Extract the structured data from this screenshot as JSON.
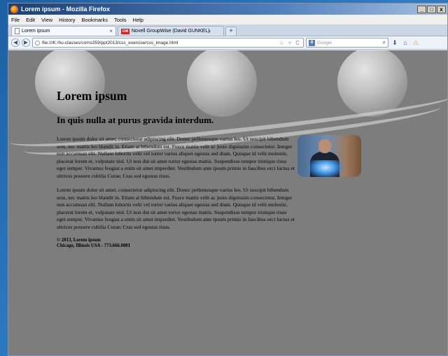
{
  "window": {
    "title": "Lorem ipsum - Mozilla Firefox",
    "controls": {
      "minimize": "_",
      "maximize": "□",
      "close": "x"
    }
  },
  "menu": [
    "File",
    "Edit",
    "View",
    "History",
    "Bookmarks",
    "Tools",
    "Help"
  ],
  "tabs": [
    {
      "label": "Lorem ipsum",
      "close": "×"
    },
    {
      "label": "Novell GroupWise (David GUNKEL)",
      "icon_text": "GW",
      "close": "×"
    }
  ],
  "newtab": "+",
  "nav": {
    "url": "file:///K:/hu-classes/coms359/ppt2013/css_exercise/css_image.html",
    "url_icons": "☆ ▿ C",
    "search_engine_icon": "8",
    "search_placeholder": "Google",
    "back": "◀",
    "forward": "▶",
    "magnifier": "⌕",
    "download": "⬇",
    "home": "⌂",
    "warning": "⚠"
  },
  "page": {
    "heading": "Lorem ipsum",
    "subheading": "In quis nulla at purus gravida interdum.",
    "paragraphs": [
      "Lorem ipsum dolor sit amet, consectetur adipiscing elit. Donec pellentesque varius leo. Ut suscipit bibendum sem, nec mattis leo blandit in. Etiam at bibendum est. Fusce mattis velit ac justo dignissim consectetur. Integer non accumsan elit. Nullam lobortis velit vel tortor varius aliquet egestas sed diam. Quisque id velit molestie, placerat lorem et, vulputate nisl. Ut non dui sit amet tortor egestas mattis. Suspendisse tempor tristique risus eget semper. Vivamus feugiat a enim sit amet imperdiet. Vestibulum ante ipsum primis in faucibus orci luctus et ultrices posuere cubilia Curae; Cras sed egestas risus.",
      "Lorem ipsum dolor sit amet, consectetur adipiscing elit. Donec pellentesque varius leo. Ut suscipit bibendum sem, nec mattis leo blandit in. Etiam at bibendum est. Fusce mattis velit ac justo dignissim consectetur. Integer non accumsan elit. Nullam lobortis velit vel tortor varius aliquet egestas sed diam. Quisque id velit molestie, placerat lorem et, vulputate nisl. Ut non dui sit amet tortor egestas mattis. Suspendisse tempor tristique risus eget semper. Vivamus feugiat a enim sit amet imperdiet. Vestibulum ante ipsum primis in faucibus orci luctus et ultrices posuere cubilia Curae; Cras sed egestas risus."
    ],
    "footer_line1": "© 2013, Lorem ipsum",
    "footer_line2": "Chicago, Illinois USA - 773.666.0001"
  }
}
